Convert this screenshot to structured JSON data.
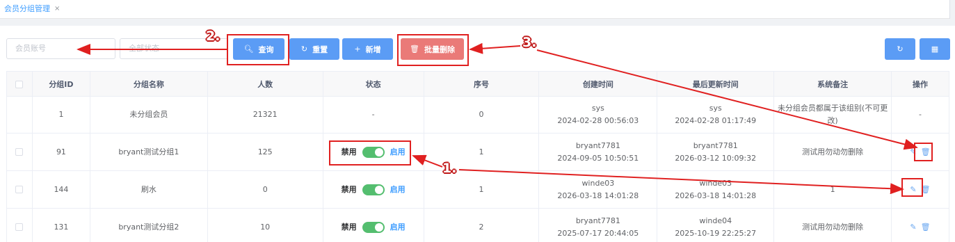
{
  "tab": {
    "label": "会员分组管理",
    "close": "×"
  },
  "filters": {
    "account_placeholder": "会员账号",
    "status_placeholder": "全部状态"
  },
  "toolbar": {
    "query": "查询",
    "reset": "重置",
    "add": "新增",
    "batch_delete": "批量删除",
    "refresh_icon": "refresh-icon",
    "grid_icon": "grid-icon"
  },
  "table": {
    "headers": [
      "分组ID",
      "分组名称",
      "人数",
      "状态",
      "序号",
      "创建时间",
      "最后更新时间",
      "系统备注",
      "操作"
    ],
    "rows": [
      {
        "id": "1",
        "name": "未分组会员",
        "count": "21321",
        "status": "-",
        "order": "0",
        "created_by": "sys",
        "created_at": "2024-02-28 00:56:03",
        "updated_by": "sys",
        "updated_at": "2024-02-28 01:17:49",
        "remark": "未分组会员都属于该组别(不可更改)",
        "op": "-"
      },
      {
        "id": "91",
        "name": "bryant测试分组1",
        "count": "125",
        "status_off": "禁用",
        "status_on": "启用",
        "order": "1",
        "created_by": "bryant7781",
        "created_at": "2024-09-05 10:50:51",
        "updated_by": "bryant7781",
        "updated_at": "2026-03-12 10:09:32",
        "remark": "测试用勿动勿删除"
      },
      {
        "id": "144",
        "name": "刷水",
        "count": "0",
        "status_off": "禁用",
        "status_on": "启用",
        "order": "1",
        "created_by": "winde03",
        "created_at": "2026-03-18 14:01:28",
        "updated_by": "winde03",
        "updated_at": "2026-03-18 14:01:28",
        "remark": "1"
      },
      {
        "id": "131",
        "name": "bryant测试分组2",
        "count": "10",
        "status_off": "禁用",
        "status_on": "启用",
        "order": "2",
        "created_by": "bryant7781",
        "created_at": "2025-07-17 20:44:05",
        "updated_by": "winde04",
        "updated_at": "2025-10-19 22:25:27",
        "remark": "测试用勿动勿删除"
      }
    ]
  },
  "annotations": {
    "n1": "1.",
    "n2": "2.",
    "n3": "3."
  },
  "colors": {
    "primary": "#5b9cf5",
    "danger": "#ea7a78",
    "switch_on": "#54be6f",
    "annotation": "#e02020"
  }
}
